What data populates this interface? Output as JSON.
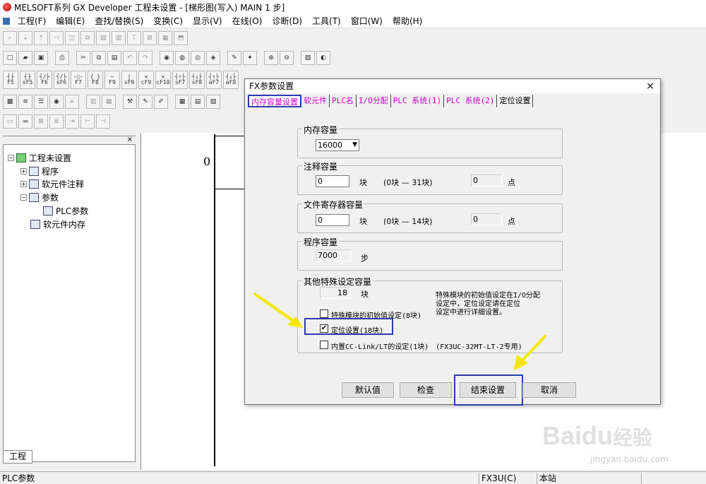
{
  "window": {
    "title": "MELSOFT系列 GX Developer 工程未设置 - [梯形图(写入)     MAIN     1 步]"
  },
  "menu": [
    "工程(F)",
    "编辑(E)",
    "查找/替换(S)",
    "变换(C)",
    "显示(V)",
    "在线(O)",
    "诊断(D)",
    "工具(T)",
    "窗口(W)",
    "帮助(H)"
  ],
  "ladder_keys": [
    "F5",
    "sF5",
    "F6",
    "sF6",
    "F7",
    "F8",
    "F9",
    "sF9",
    "cF9",
    "cF10",
    "sF7",
    "sF8",
    "aF7",
    "aF8"
  ],
  "tree": {
    "close": "×",
    "root": "工程未设置",
    "items": [
      "程序",
      "软元件注释",
      "参数",
      "PLC参数",
      "软元件内存"
    ],
    "tab": "工程"
  },
  "ladder": {
    "step": "0"
  },
  "status": {
    "left": "PLC参数",
    "cpu": "FX3U(C)",
    "station": "本站"
  },
  "dialog": {
    "title": "FX参数设置",
    "close": "×",
    "tabs": [
      "内存容量设置",
      "软元件",
      "PLC名",
      "I/O分配",
      "PLC 系统(1)",
      "PLC 系统(2)",
      "定位设置"
    ],
    "memory": {
      "label": "内存容量",
      "value": "16000",
      "arrow": "▼"
    },
    "comment": {
      "label": "注释容量",
      "value": "0",
      "unit": "块",
      "range": "(0块 — 31块)",
      "points": "0",
      "points_unit": "点"
    },
    "filereg": {
      "label": "文件寄存器容量",
      "value": "0",
      "unit": "块",
      "range": "(0块 — 14块)",
      "points": "0",
      "points_unit": "点"
    },
    "program": {
      "label": "程序容量",
      "value": "7000",
      "unit": "步"
    },
    "special": {
      "label": "其他特殊设定容量",
      "value": "18",
      "unit": "块",
      "note1": "特殊模块的初始值设定在I/O分配",
      "note2": "设定中，定位设定请在定位",
      "note3": "设定中进行详细设置。",
      "opt1": "特殊模块的初始值设定(8块)",
      "opt2": "定位设置(18块)",
      "opt3": "内置CC-Link/LT的设定(1块)　(FX3UC-32MT-LT-2专用)",
      "check": "✔"
    },
    "buttons": {
      "default": "默认值",
      "check": "检查",
      "finish": "结束设置",
      "cancel": "取消"
    }
  },
  "watermark": {
    "brand": "Bai",
    "paw": "du",
    "cn": "经验",
    "url": "jingyan.baidu.com"
  },
  "colors": {
    "highlight": "#2a3cb0",
    "arrow": "#f2e800",
    "tab_text": "#cc00cc"
  }
}
